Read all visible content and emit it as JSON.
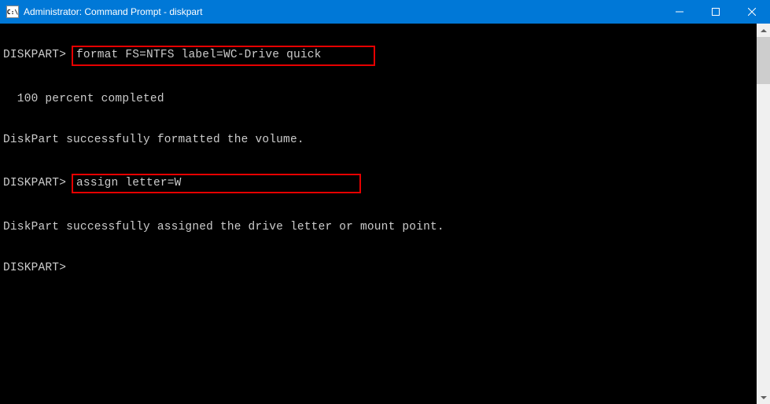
{
  "titlebar": {
    "icon_text": "C:\\",
    "title": "Administrator: Command Prompt - diskpart"
  },
  "terminal": {
    "prompt1": "DISKPART>",
    "command1": "format FS=NTFS label=WC-Drive quick",
    "progress": "  100 percent completed",
    "result1": "DiskPart successfully formatted the volume.",
    "prompt2": "DISKPART>",
    "command2": "assign letter=W",
    "result2": "DiskPart successfully assigned the drive letter or mount point.",
    "prompt3": "DISKPART>"
  }
}
